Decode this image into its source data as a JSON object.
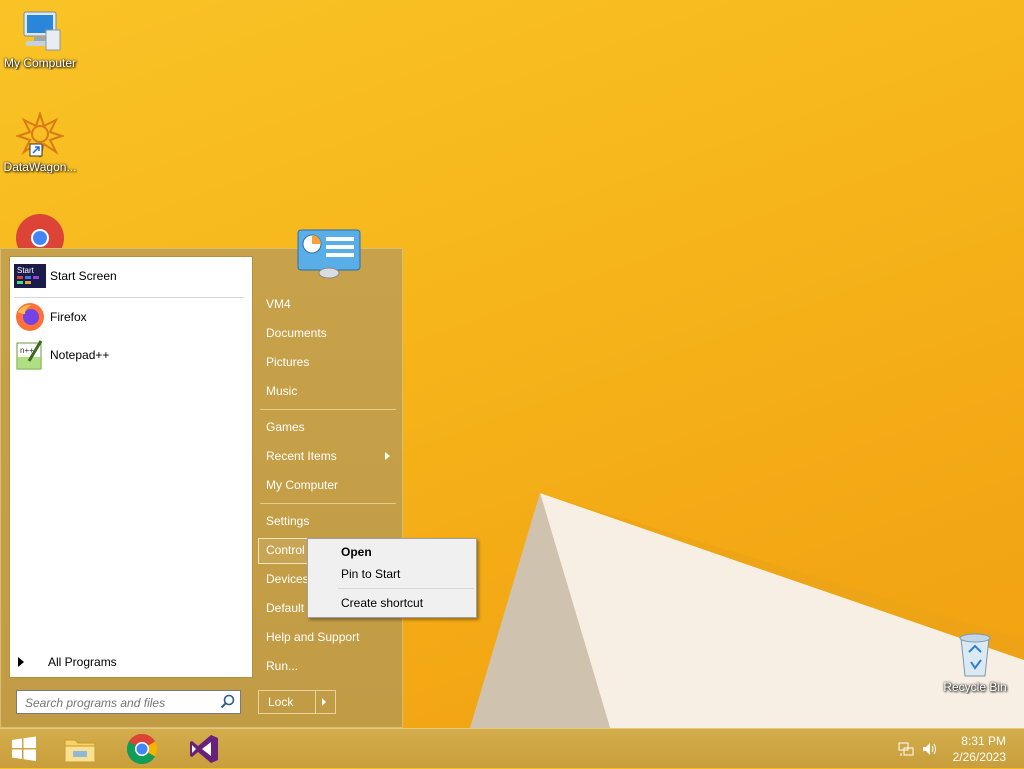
{
  "desktop": {
    "icons": [
      {
        "label": "My Computer"
      },
      {
        "label": "DataWagon..."
      },
      {
        "label": "Recycle Bin"
      }
    ]
  },
  "start_menu": {
    "pinned": [
      {
        "label": "Start Screen",
        "icon": "start-screen-icon"
      },
      {
        "label": "Firefox",
        "icon": "firefox-icon"
      },
      {
        "label": "Notepad++",
        "icon": "notepad-plus-plus-icon"
      }
    ],
    "all_programs": "All Programs",
    "search_placeholder": "Search programs and files",
    "right": {
      "items": [
        "VM4",
        "Documents",
        "Pictures",
        "Music",
        "Games",
        "Recent Items",
        "My Computer",
        "Settings",
        "Control Panel",
        "Devices",
        "Default",
        "Help and Support",
        "Run..."
      ],
      "control_panel_visible": "Control",
      "devices_visible": "Devices",
      "default_visible": "Default"
    },
    "lock_label": "Lock"
  },
  "context_menu": {
    "items": [
      "Open",
      "Pin to Start",
      "Create shortcut"
    ]
  },
  "taskbar": {
    "apps": [
      "windows-start-icon",
      "file-explorer-icon",
      "chrome-icon",
      "visual-studio-icon"
    ],
    "time": "8:31 PM",
    "date": "2/26/2023"
  },
  "colors": {
    "wallpaper": "#f6b61b",
    "menu_bg": "#c29c45",
    "taskbar_bg": "#c99e3c"
  }
}
